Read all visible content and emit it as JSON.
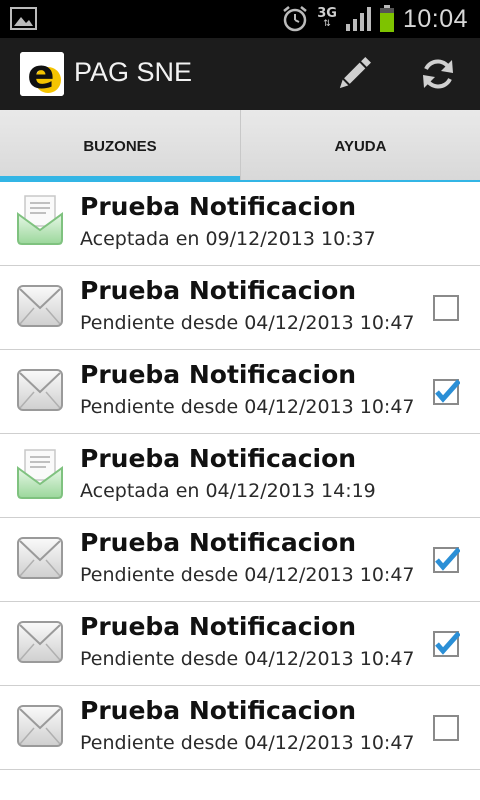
{
  "status": {
    "clock": "10:04",
    "network": "3G"
  },
  "actionbar": {
    "title": "PAG SNE"
  },
  "tabs": [
    {
      "label": "BUZONES",
      "selected": true
    },
    {
      "label": "AYUDA",
      "selected": false
    }
  ],
  "colors": {
    "accent": "#33b5e5",
    "actionbar": "#1c1c1c",
    "checkmark": "#2b8fd6"
  },
  "notifications": [
    {
      "title": "Prueba Notificacion",
      "subtitle": "Aceptada en 09/12/2013 10:37",
      "state": "opened",
      "checkbox": null
    },
    {
      "title": "Prueba Notificacion",
      "subtitle": "Pendiente desde 04/12/2013 10:47",
      "state": "closed",
      "checkbox": false
    },
    {
      "title": "Prueba Notificacion",
      "subtitle": "Pendiente desde 04/12/2013 10:47",
      "state": "closed",
      "checkbox": true
    },
    {
      "title": "Prueba Notificacion",
      "subtitle": "Aceptada en 04/12/2013 14:19",
      "state": "opened",
      "checkbox": null
    },
    {
      "title": "Prueba Notificacion",
      "subtitle": "Pendiente desde 04/12/2013 10:47",
      "state": "closed",
      "checkbox": true
    },
    {
      "title": "Prueba Notificacion",
      "subtitle": "Pendiente desde 04/12/2013 10:47",
      "state": "closed",
      "checkbox": true
    },
    {
      "title": "Prueba Notificacion",
      "subtitle": "Pendiente desde 04/12/2013 10:47",
      "state": "closed",
      "checkbox": false
    }
  ]
}
